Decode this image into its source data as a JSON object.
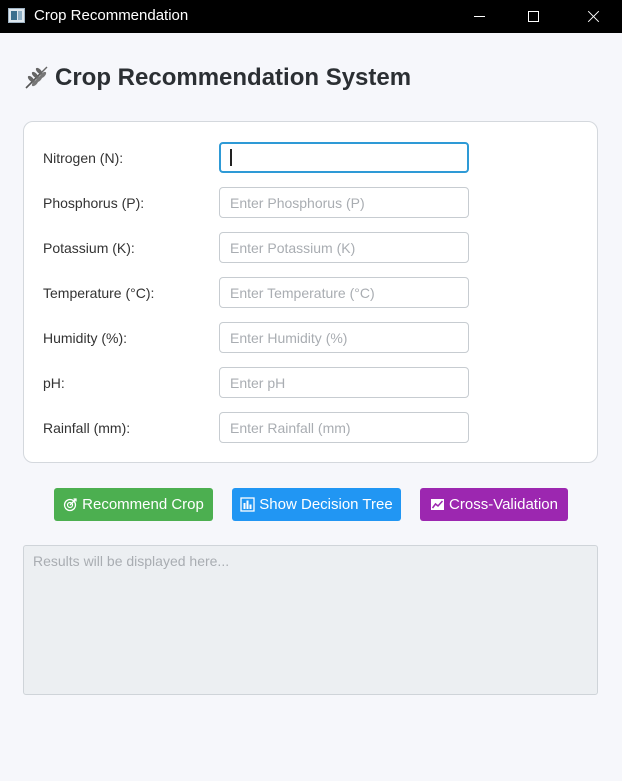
{
  "window": {
    "title": "Crop Recommendation"
  },
  "header": {
    "title": "Crop Recommendation System",
    "icon": "wheat-icon"
  },
  "form": {
    "fields": [
      {
        "label": "Nitrogen (N):",
        "value": "",
        "placeholder": ""
      },
      {
        "label": "Phosphorus (P):",
        "value": "",
        "placeholder": "Enter Phosphorus (P)"
      },
      {
        "label": "Potassium (K):",
        "value": "",
        "placeholder": "Enter Potassium (K)"
      },
      {
        "label": "Temperature (°C):",
        "value": "",
        "placeholder": "Enter Temperature (°C)"
      },
      {
        "label": "Humidity (%):",
        "value": "",
        "placeholder": "Enter Humidity (%)"
      },
      {
        "label": "pH:",
        "value": "",
        "placeholder": "Enter pH"
      },
      {
        "label": "Rainfall (mm):",
        "value": "",
        "placeholder": "Enter Rainfall (mm)"
      }
    ]
  },
  "buttons": {
    "recommend": {
      "label": "Recommend Crop",
      "color": "#4caf50",
      "icon": "target-icon"
    },
    "decision_tree": {
      "label": "Show Decision Tree",
      "color": "#2196f3",
      "icon": "bar-chart-icon"
    },
    "cross_validation": {
      "label": "Cross-Validation",
      "color": "#9c27b0",
      "icon": "line-chart-icon"
    }
  },
  "results": {
    "value": "",
    "placeholder": "Results will be displayed here..."
  },
  "colors": {
    "focus_border": "#2e9ad6",
    "background": "#f6f7fb"
  }
}
